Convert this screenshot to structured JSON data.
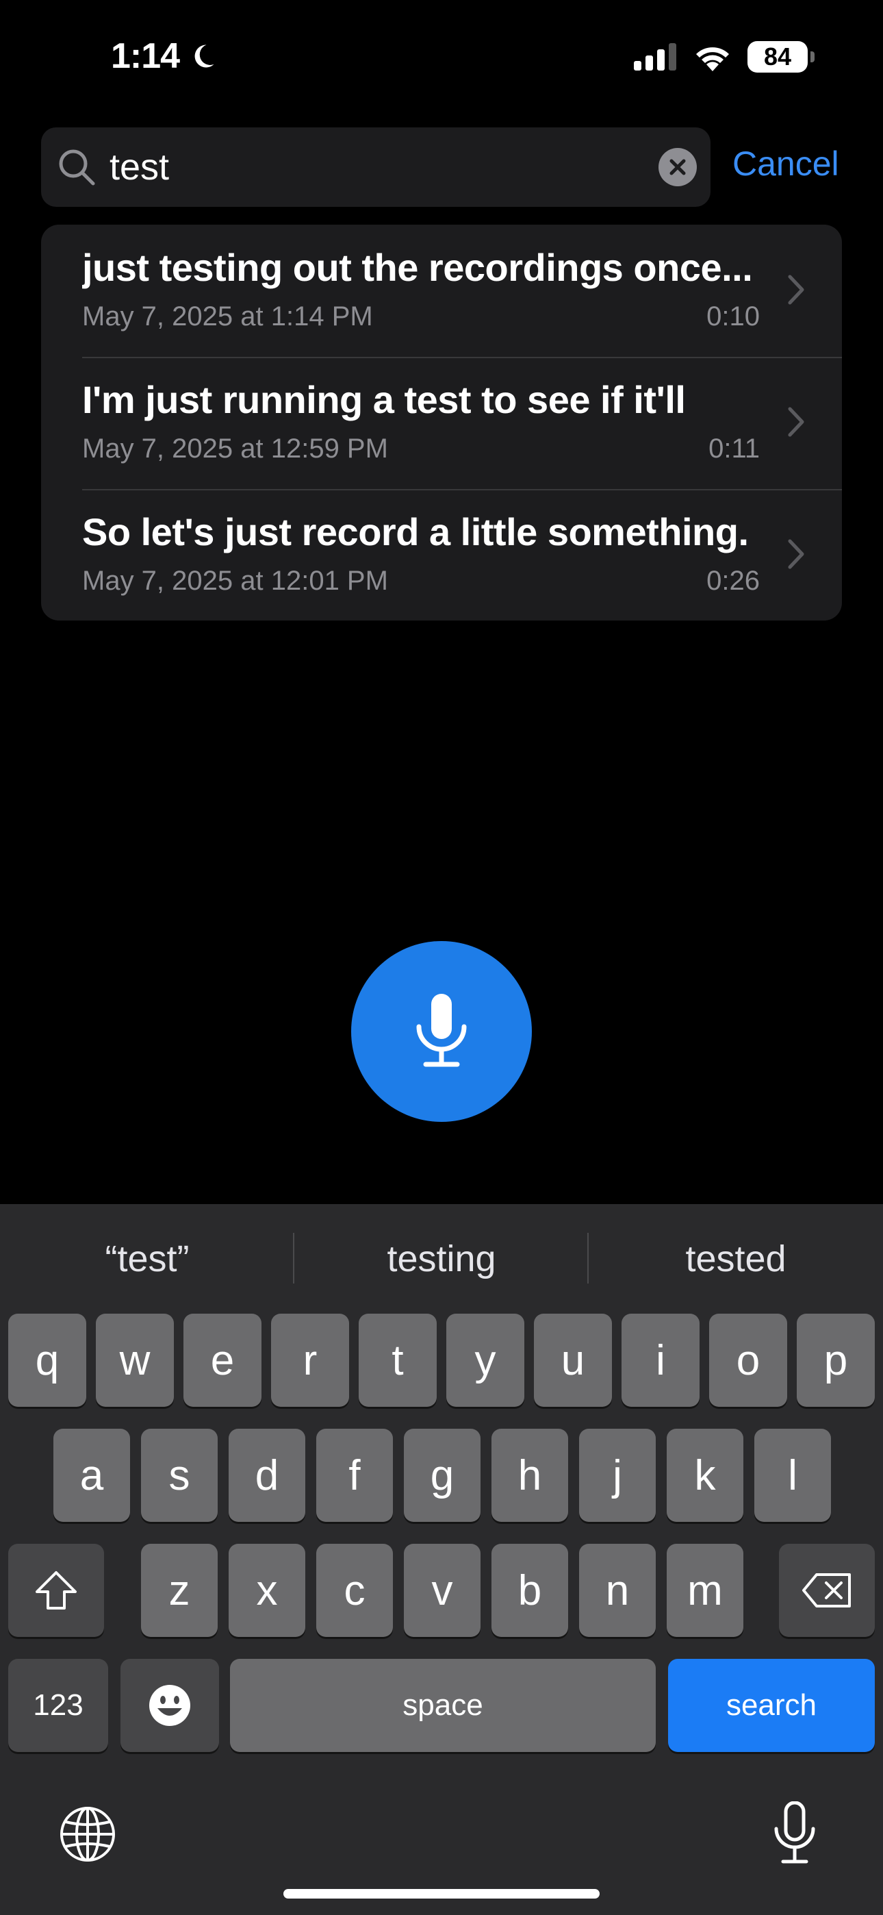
{
  "status_bar": {
    "time": "1:14",
    "battery": "84"
  },
  "search": {
    "query": "test",
    "cancel_label": "Cancel"
  },
  "results": [
    {
      "title": "just testing out the recordings once...",
      "date": "May 7, 2025 at 1:14 PM",
      "duration": "0:10"
    },
    {
      "title": "I'm just running a test to see if it'll",
      "date": "May 7, 2025 at 12:59 PM",
      "duration": "0:11"
    },
    {
      "title": "So let's just record a little something.",
      "date": "May 7, 2025 at 12:01 PM",
      "duration": "0:26"
    }
  ],
  "keyboard": {
    "suggestions": [
      "“test”",
      "testing",
      "tested"
    ],
    "row1": [
      "q",
      "w",
      "e",
      "r",
      "t",
      "y",
      "u",
      "i",
      "o",
      "p"
    ],
    "row2": [
      "a",
      "s",
      "d",
      "f",
      "g",
      "h",
      "j",
      "k",
      "l"
    ],
    "row3": [
      "z",
      "x",
      "c",
      "v",
      "b",
      "n",
      "m"
    ],
    "numbers_label": "123",
    "space_label": "space",
    "search_label": "search"
  },
  "colors": {
    "accent": "#1e7de8",
    "cancel": "#3a8df5",
    "key": "#6b6b6d",
    "keyboard_bg": "#2a2a2c"
  }
}
